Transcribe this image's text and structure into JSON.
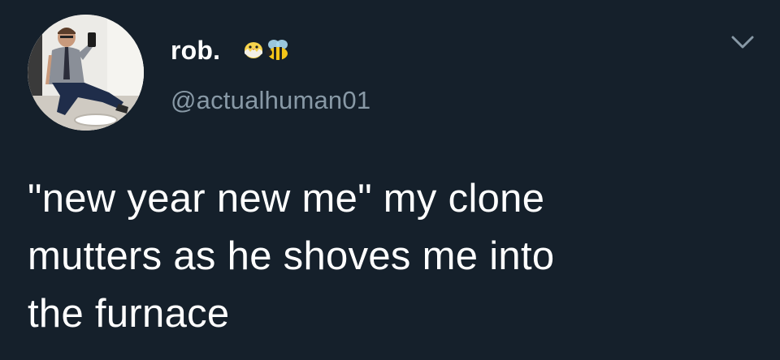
{
  "user": {
    "display_name": "rob.",
    "handle": "@actualhuman01",
    "emojis": [
      "hatching-chick-emoji",
      "bee-emoji"
    ],
    "avatar_icon": "profile-photo-avatar"
  },
  "menu": {
    "icon": "chevron-down-icon"
  },
  "tweet": {
    "lines": [
      "\"new year new me\" my clone",
      "mutters as he shoves me into",
      "the furnace"
    ]
  },
  "colors": {
    "background": "#15202b",
    "text": "#ffffff",
    "secondary_text": "#8899a6"
  }
}
